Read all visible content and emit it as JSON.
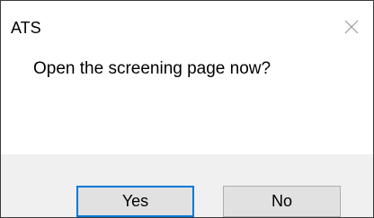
{
  "window": {
    "title": "ATS",
    "close_icon": "close-icon"
  },
  "message": "Open the screening page now?",
  "buttons": {
    "yes_label": "Yes",
    "no_label": "No"
  },
  "colors": {
    "default_button_border": "#0078d7",
    "button_background": "#e1e1e1",
    "footer_background": "#f0f0f0"
  }
}
